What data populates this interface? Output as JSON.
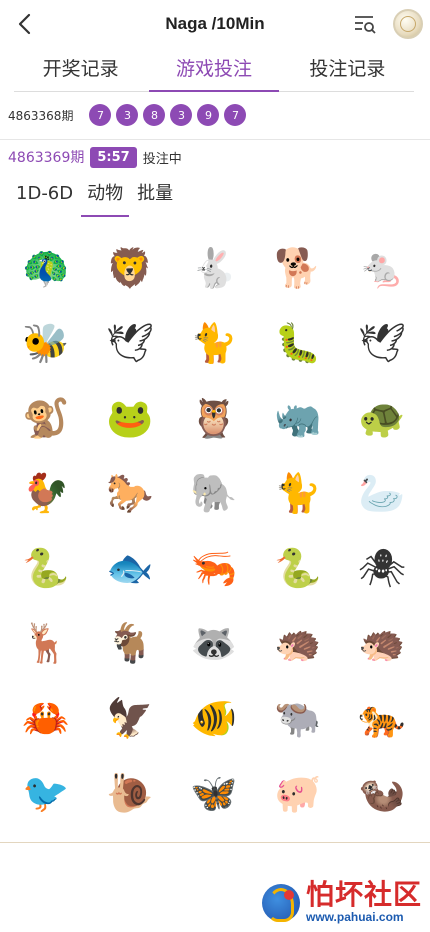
{
  "header": {
    "title": "Naga /10Min",
    "back_icon": "chevron-left-icon",
    "menu_icon": "list-search-icon",
    "avatar_icon": "coin-icon"
  },
  "main_tabs": [
    {
      "label": "开奖记录",
      "active": false
    },
    {
      "label": "游戏投注",
      "active": true
    },
    {
      "label": "投注记录",
      "active": false
    }
  ],
  "previous_result": {
    "issue": "4863368期",
    "balls": [
      "7",
      "3",
      "8",
      "3",
      "9",
      "7"
    ]
  },
  "current": {
    "issue": "4863369期",
    "countdown": "5:57",
    "status": "投注中"
  },
  "sub_tabs": [
    {
      "label": "1D-6D",
      "active": false
    },
    {
      "label": "动物",
      "active": true
    },
    {
      "label": "批量",
      "active": false
    }
  ],
  "animals": [
    {
      "name": "peacock",
      "glyph": "🦚"
    },
    {
      "name": "lion",
      "glyph": "🦁"
    },
    {
      "name": "rabbit",
      "glyph": "🐇"
    },
    {
      "name": "dog",
      "glyph": "🐕"
    },
    {
      "name": "mouse",
      "glyph": "🐁"
    },
    {
      "name": "bee",
      "glyph": "🐝"
    },
    {
      "name": "crane",
      "glyph": "🕊"
    },
    {
      "name": "lynx",
      "glyph": "🐈"
    },
    {
      "name": "centipede",
      "glyph": "🐛"
    },
    {
      "name": "pigeon",
      "glyph": "🕊"
    },
    {
      "name": "monkey",
      "glyph": "🐒"
    },
    {
      "name": "frog",
      "glyph": "🐸"
    },
    {
      "name": "owl",
      "glyph": "🦉"
    },
    {
      "name": "rhino",
      "glyph": "🦏"
    },
    {
      "name": "turtle",
      "glyph": "🐢"
    },
    {
      "name": "rooster",
      "glyph": "🐓"
    },
    {
      "name": "horse",
      "glyph": "🐎"
    },
    {
      "name": "elephant",
      "glyph": "🐘"
    },
    {
      "name": "cat",
      "glyph": "🐈"
    },
    {
      "name": "goose",
      "glyph": "🦢"
    },
    {
      "name": "eel",
      "glyph": "🐍"
    },
    {
      "name": "fish",
      "glyph": "🐟"
    },
    {
      "name": "shrimp",
      "glyph": "🦐"
    },
    {
      "name": "snake",
      "glyph": "🐍"
    },
    {
      "name": "spider",
      "glyph": "🕷"
    },
    {
      "name": "moose",
      "glyph": "🦌"
    },
    {
      "name": "goat",
      "glyph": "🐐"
    },
    {
      "name": "raccoon",
      "glyph": "🦝"
    },
    {
      "name": "pangolin",
      "glyph": "🦔"
    },
    {
      "name": "hedgehog",
      "glyph": "🦔"
    },
    {
      "name": "crab",
      "glyph": "🦀"
    },
    {
      "name": "eagle",
      "glyph": "🦅"
    },
    {
      "name": "goldfish",
      "glyph": "🐠"
    },
    {
      "name": "buffalo",
      "glyph": "🐃"
    },
    {
      "name": "tiger",
      "glyph": "🐅"
    },
    {
      "name": "swallow",
      "glyph": "🐦"
    },
    {
      "name": "snail",
      "glyph": "🐌"
    },
    {
      "name": "butterfly",
      "glyph": "🦋"
    },
    {
      "name": "pig",
      "glyph": "🐖"
    },
    {
      "name": "otter",
      "glyph": "🦦"
    }
  ],
  "watermark": {
    "title": "怕坏社区",
    "url": "www.pahuai.com"
  },
  "colors": {
    "accent": "#8d4ab4",
    "watermark_red": "#d62b2b",
    "watermark_blue": "#1c5bb0"
  }
}
